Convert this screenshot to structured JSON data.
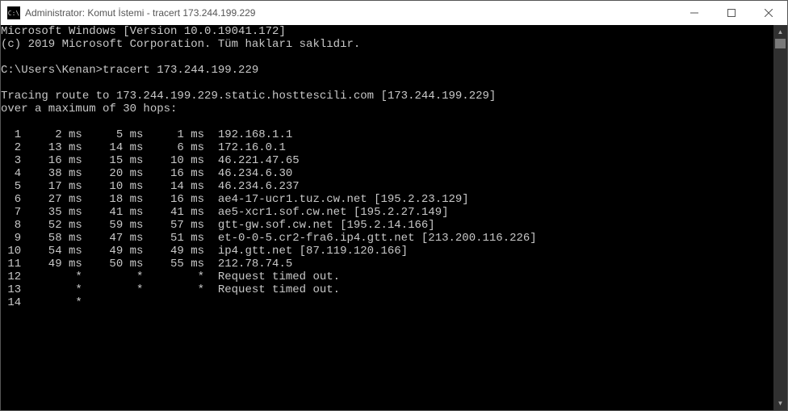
{
  "titlebar": {
    "icon_text": "C:\\",
    "title": "Administrator: Komut İstemi - tracert  173.244.199.229"
  },
  "console": {
    "header": {
      "line1": "Microsoft Windows [Version 10.0.19041.172]",
      "line2": "(c) 2019 Microsoft Corporation. Tüm hakları saklıdır."
    },
    "prompt": "C:\\Users\\Kenan>tracert 173.244.199.229",
    "trace": {
      "intro1": "Tracing route to 173.244.199.229.static.hosttescili.com [173.244.199.229]",
      "intro2": "over a maximum of 30 hops:",
      "hops": [
        {
          "n": 1,
          "t1": "2 ms",
          "t2": "5 ms",
          "t3": "1 ms",
          "host": "192.168.1.1"
        },
        {
          "n": 2,
          "t1": "13 ms",
          "t2": "14 ms",
          "t3": "6 ms",
          "host": "172.16.0.1"
        },
        {
          "n": 3,
          "t1": "16 ms",
          "t2": "15 ms",
          "t3": "10 ms",
          "host": "46.221.47.65"
        },
        {
          "n": 4,
          "t1": "38 ms",
          "t2": "20 ms",
          "t3": "16 ms",
          "host": "46.234.6.30"
        },
        {
          "n": 5,
          "t1": "17 ms",
          "t2": "10 ms",
          "t3": "14 ms",
          "host": "46.234.6.237"
        },
        {
          "n": 6,
          "t1": "27 ms",
          "t2": "18 ms",
          "t3": "16 ms",
          "host": "ae4-17-ucr1.tuz.cw.net [195.2.23.129]"
        },
        {
          "n": 7,
          "t1": "35 ms",
          "t2": "41 ms",
          "t3": "41 ms",
          "host": "ae5-xcr1.sof.cw.net [195.2.27.149]"
        },
        {
          "n": 8,
          "t1": "52 ms",
          "t2": "59 ms",
          "t3": "57 ms",
          "host": "gtt-gw.sof.cw.net [195.2.14.166]"
        },
        {
          "n": 9,
          "t1": "58 ms",
          "t2": "47 ms",
          "t3": "51 ms",
          "host": "et-0-0-5.cr2-fra6.ip4.gtt.net [213.200.116.226]"
        },
        {
          "n": 10,
          "t1": "54 ms",
          "t2": "49 ms",
          "t3": "49 ms",
          "host": "ip4.gtt.net [87.119.120.166]"
        },
        {
          "n": 11,
          "t1": "49 ms",
          "t2": "50 ms",
          "t3": "55 ms",
          "host": "212.78.74.5"
        },
        {
          "n": 12,
          "t1": "*",
          "t2": "*",
          "t3": "*",
          "host": "Request timed out."
        },
        {
          "n": 13,
          "t1": "*",
          "t2": "*",
          "t3": "*",
          "host": "Request timed out."
        },
        {
          "n": 14,
          "t1": "*",
          "t2": "",
          "t3": "",
          "host": ""
        }
      ]
    }
  }
}
